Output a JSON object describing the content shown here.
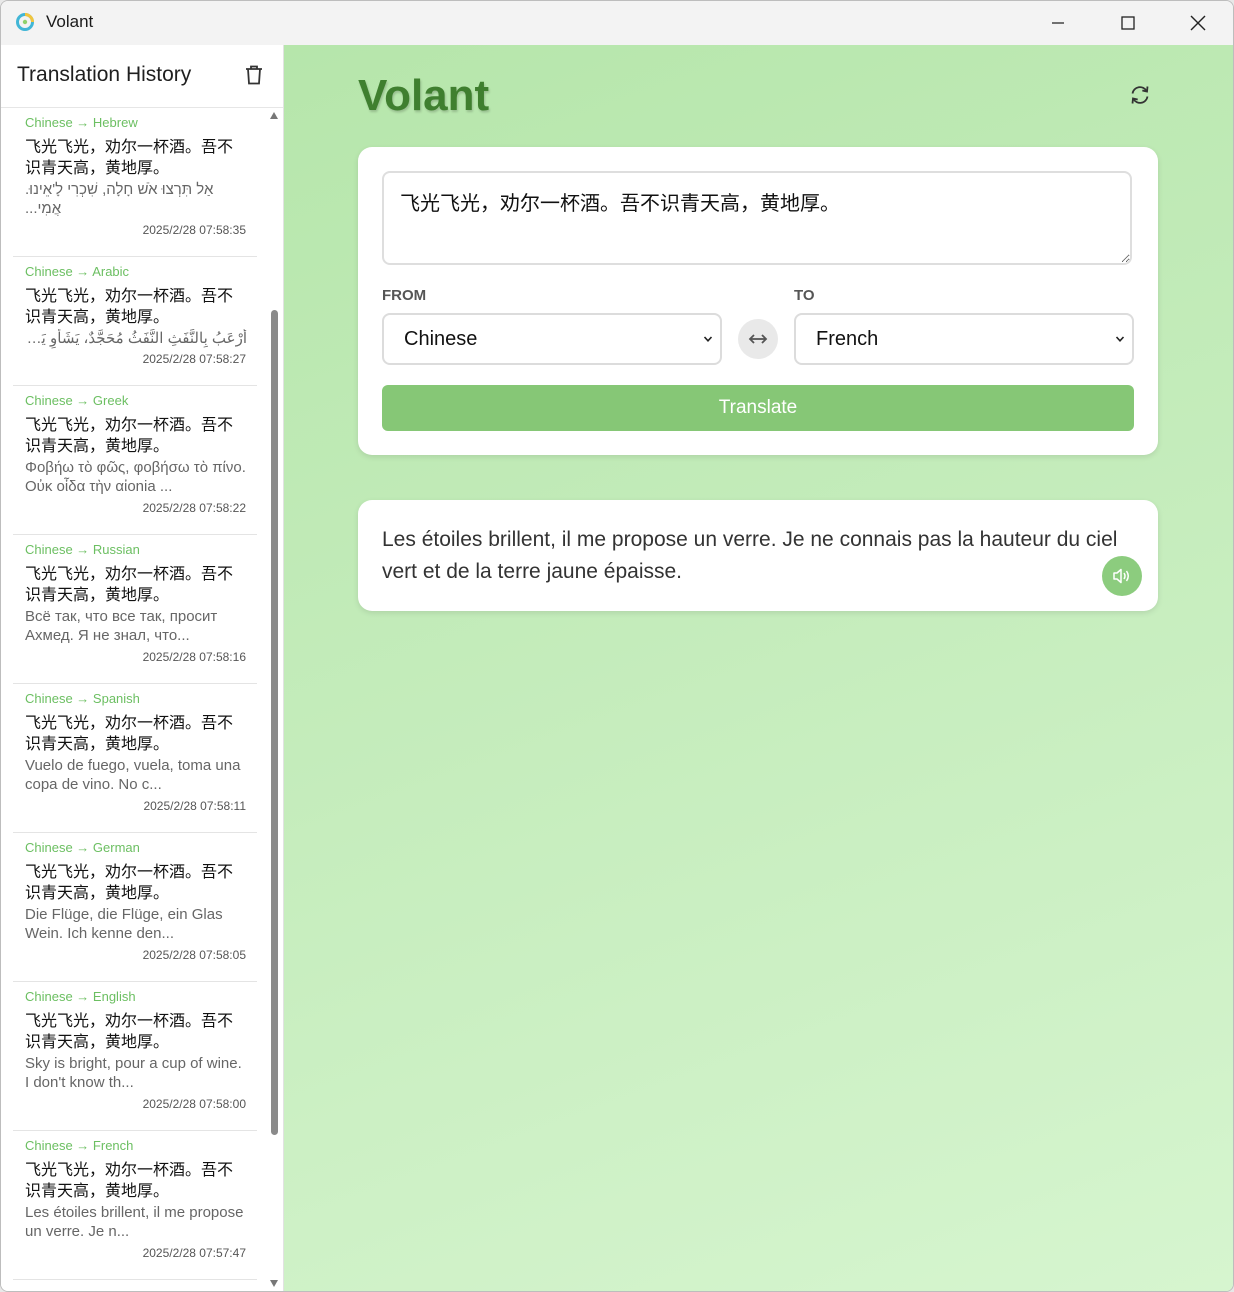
{
  "window": {
    "title": "Volant"
  },
  "sidebar": {
    "title": "Translation History",
    "items": [
      {
        "langs": "Chinese → Hebrew",
        "source": "飞光飞光，劝尔一杯酒。吾不识青天高，黄地厚。",
        "target": "אַל תִּרְצוּ אֹשׁ חָלָה, שִׁכְרִי לָ'אֵינוּ. אֲמִי...",
        "time": "2025/2/28 07:58:35"
      },
      {
        "langs": "Chinese → Arabic",
        "source": "飞光飞光，劝尔一杯酒。吾不识青天高，黄地厚。",
        "target": "أَرْعَبُ بِالنَّفَثِ النَّفَثُ مُحَجَّدٌ، يَشَأْوِ يَا...",
        "time": "2025/2/28 07:58:27"
      },
      {
        "langs": "Chinese → Greek",
        "source": "飞光飞光，劝尔一杯酒。吾不识青天高，黄地厚。",
        "target": "Φοβήω τὸ φῶς, φοβήσω τὸ πίνο. Οὐκ οἶδα τὴν αἰonia ...",
        "time": "2025/2/28 07:58:22"
      },
      {
        "langs": "Chinese → Russian",
        "source": "飞光飞光，劝尔一杯酒。吾不识青天高，黄地厚。",
        "target": "Всё так, что все так, просит Ахмед. Я не знал, что...",
        "time": "2025/2/28 07:58:16"
      },
      {
        "langs": "Chinese → Spanish",
        "source": "飞光飞光，劝尔一杯酒。吾不识青天高，黄地厚。",
        "target": "Vuelo de fuego, vuela, toma una copa de vino. No c...",
        "time": "2025/2/28 07:58:11"
      },
      {
        "langs": "Chinese → German",
        "source": "飞光飞光，劝尔一杯酒。吾不识青天高，黄地厚。",
        "target": "Die Flüge, die Flüge, ein Glas Wein. Ich kenne den...",
        "time": "2025/2/28 07:58:05"
      },
      {
        "langs": "Chinese → English",
        "source": "飞光飞光，劝尔一杯酒。吾不识青天高，黄地厚。",
        "target": "Sky is bright, pour a cup of wine. I don't know th...",
        "time": "2025/2/28 07:58:00"
      },
      {
        "langs": "Chinese → French",
        "source": "飞光飞光，劝尔一杯酒。吾不识青天高，黄地厚。",
        "target": "Les étoiles brillent, il me propose un verre. Je n...",
        "time": "2025/2/28 07:57:47"
      }
    ]
  },
  "main": {
    "app_title": "Volant",
    "source_text": "飞光飞光，劝尔一杯酒。吾不识青天高，黄地厚。",
    "from_label": "FROM",
    "to_label": "TO",
    "from_language": "Chinese",
    "to_language": "French",
    "translate_label": "Translate",
    "output_text": "Les étoiles brillent, il me propose un verre. Je ne connais pas la hauteur du ciel vert et de la terre jaune épaisse."
  },
  "colors": {
    "accent": "#86c776",
    "title_green": "#3f7f2f",
    "lang_green": "#6cbf62"
  },
  "icons": {
    "app": "volant-logo-icon",
    "minimize": "minimize-icon",
    "maximize": "maximize-icon",
    "close": "close-icon",
    "trash": "trash-icon",
    "refresh": "refresh-icon",
    "swap": "swap-arrows-icon",
    "speaker": "speaker-icon",
    "chevron": "chevron-down-icon"
  }
}
